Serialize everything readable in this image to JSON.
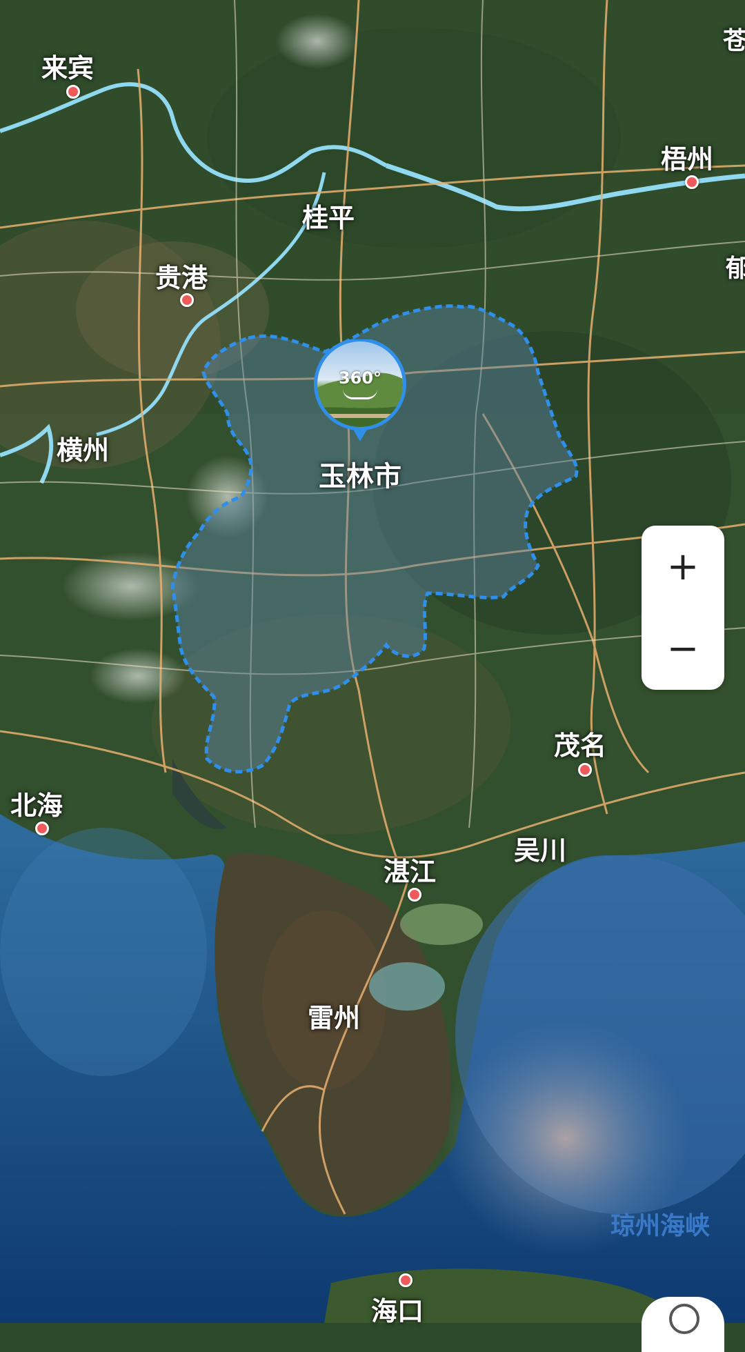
{
  "map": {
    "region_name": "玉林市",
    "pano_label": "360°",
    "cities": [
      {
        "name": "来宾",
        "has_dot": true
      },
      {
        "name": "梧州",
        "has_dot": true
      },
      {
        "name": "桂平",
        "has_dot": false
      },
      {
        "name": "贵港",
        "has_dot": true
      },
      {
        "name": "横州",
        "has_dot": false
      },
      {
        "name": "茂名",
        "has_dot": true
      },
      {
        "name": "北海",
        "has_dot": true
      },
      {
        "name": "吴川",
        "has_dot": false
      },
      {
        "name": "湛江",
        "has_dot": true
      },
      {
        "name": "雷州",
        "has_dot": false
      },
      {
        "name": "海口",
        "has_dot": true
      },
      {
        "name": "苍",
        "has_dot": false
      },
      {
        "name": "郁",
        "has_dot": false
      }
    ],
    "sea_label": "琼州海峡",
    "boundary_color": "#2f8fea",
    "river_color": "#8fd8f0",
    "road_color": "#e8b070"
  },
  "controls": {
    "zoom_in": "+",
    "zoom_out": "−"
  }
}
